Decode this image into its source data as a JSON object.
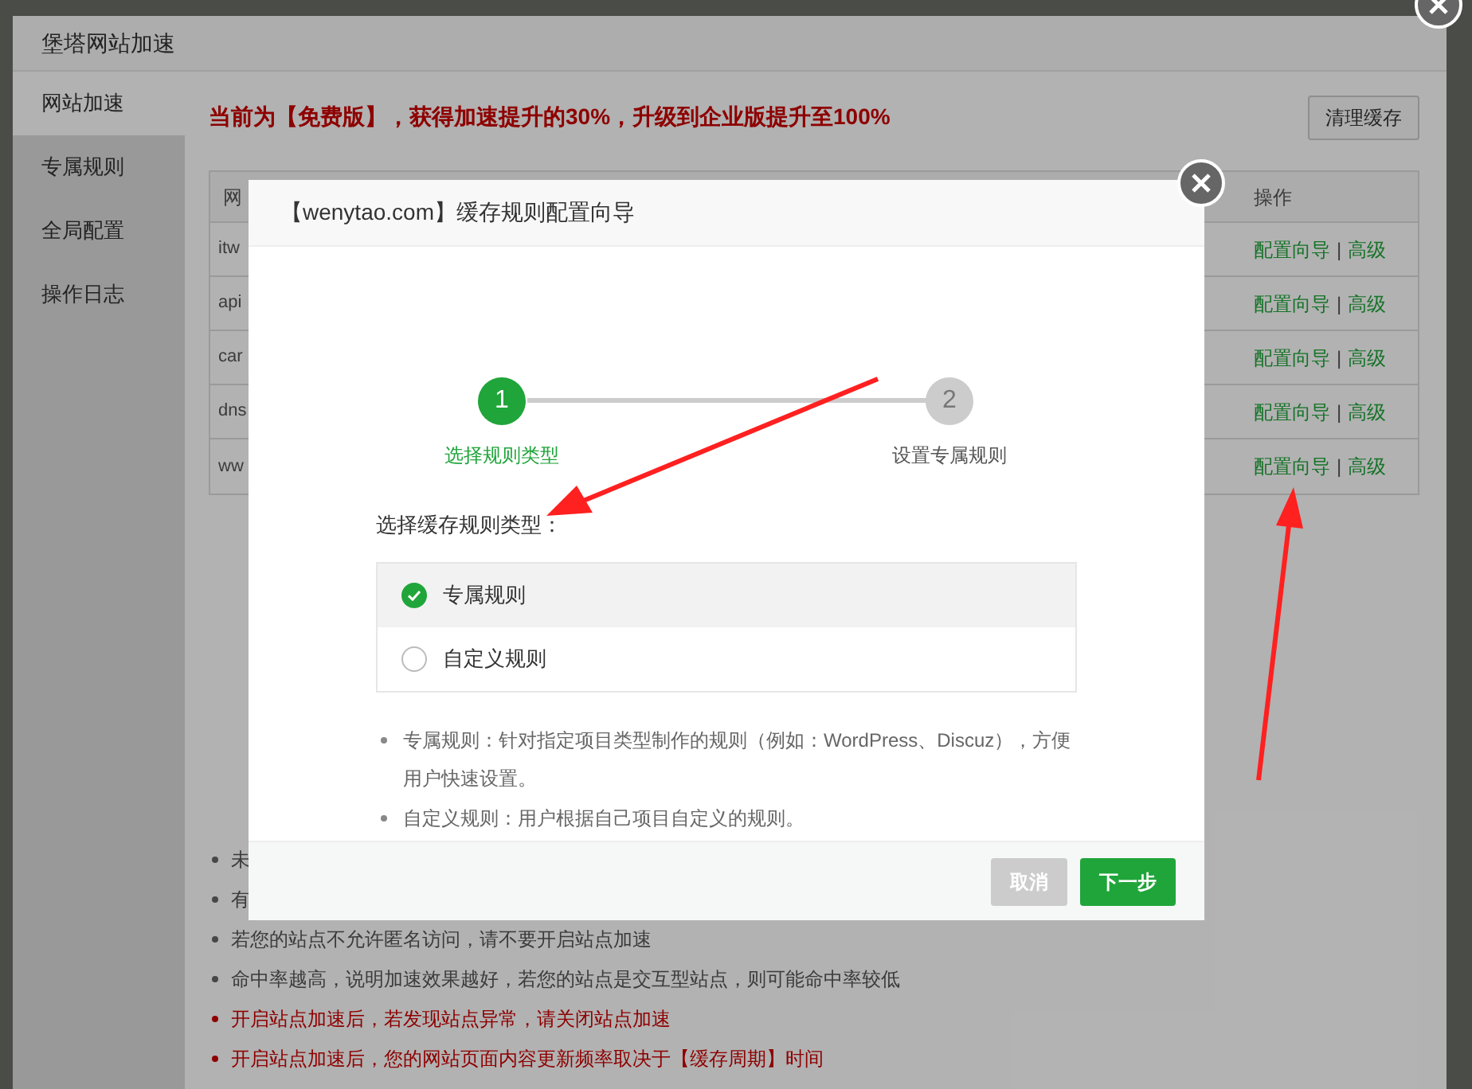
{
  "window": {
    "title": "堡塔网站加速"
  },
  "sidebar": {
    "items": [
      {
        "label": "网站加速",
        "selected": true
      },
      {
        "label": "专属规则",
        "selected": false
      },
      {
        "label": "全局配置",
        "selected": false
      },
      {
        "label": "操作日志",
        "selected": false
      }
    ]
  },
  "notice": "当前为【免费版】，获得加速提升的30%，升级到企业版提升至100%",
  "clear_cache_button": "清理缓存",
  "table": {
    "columns": [
      "网",
      "操作"
    ],
    "rows": [
      {
        "site": "itw",
        "actions": [
          "配置向导",
          "|",
          "高级"
        ]
      },
      {
        "site": "api",
        "actions": [
          "配置向导",
          "|",
          "高级"
        ]
      },
      {
        "site": "car",
        "actions": [
          "配置向导",
          "|",
          "高级"
        ]
      },
      {
        "site": "dns",
        "actions": [
          "配置向导",
          "|",
          "高级"
        ]
      },
      {
        "site": "ww",
        "actions": [
          "配置向导",
          "|",
          "高级"
        ]
      }
    ]
  },
  "tips": [
    {
      "text": "未",
      "warning": false
    },
    {
      "text": "有",
      "warning": false
    },
    {
      "text": "若您的站点不允许匿名访问，请不要开启站点加速",
      "warning": false
    },
    {
      "text": "命中率越高，说明加速效果越好，若您的站点是交互型站点，则可能命中率较低",
      "warning": false
    },
    {
      "text": "开启站点加速后，若发现站点异常，请关闭站点加速",
      "warning": true
    },
    {
      "text": "开启站点加速后，您的网站页面内容更新频率取决于【缓存周期】时间",
      "warning": true
    }
  ],
  "dialog": {
    "title": "【wenytao.com】缓存规则配置向导",
    "steps": [
      {
        "number": "1",
        "label": "选择规则类型",
        "active": true
      },
      {
        "number": "2",
        "label": "设置专属规则",
        "active": false
      }
    ],
    "prompt": "选择缓存规则类型：",
    "options": [
      {
        "label": "专属规则",
        "selected": true
      },
      {
        "label": "自定义规则",
        "selected": false
      }
    ],
    "notes": [
      "专属规则：针对指定项目类型制作的规则（例如：WordPress、Discuz），方便用户快速设置。",
      "自定义规则：用户根据自己项目自定义的规则。"
    ],
    "buttons": [
      {
        "label": "取消",
        "disabled": true
      },
      {
        "label": "下一步",
        "disabled": false
      }
    ]
  }
}
